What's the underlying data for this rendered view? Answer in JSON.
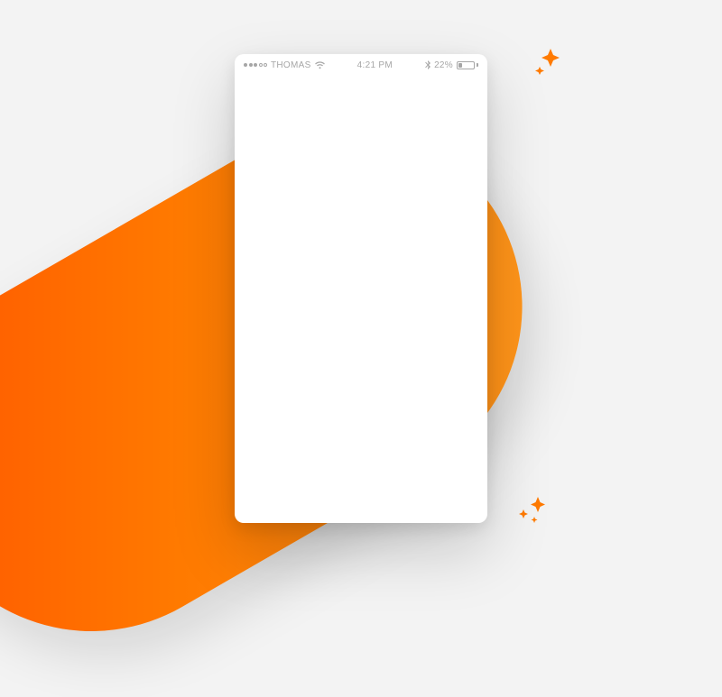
{
  "colors": {
    "accent": "#ff7a00",
    "bg": "#f3f3f3",
    "status_text": "#a6a6a6"
  },
  "status_bar": {
    "carrier": "THOMAS",
    "time": "4:21 PM",
    "battery_percent": "22%"
  }
}
